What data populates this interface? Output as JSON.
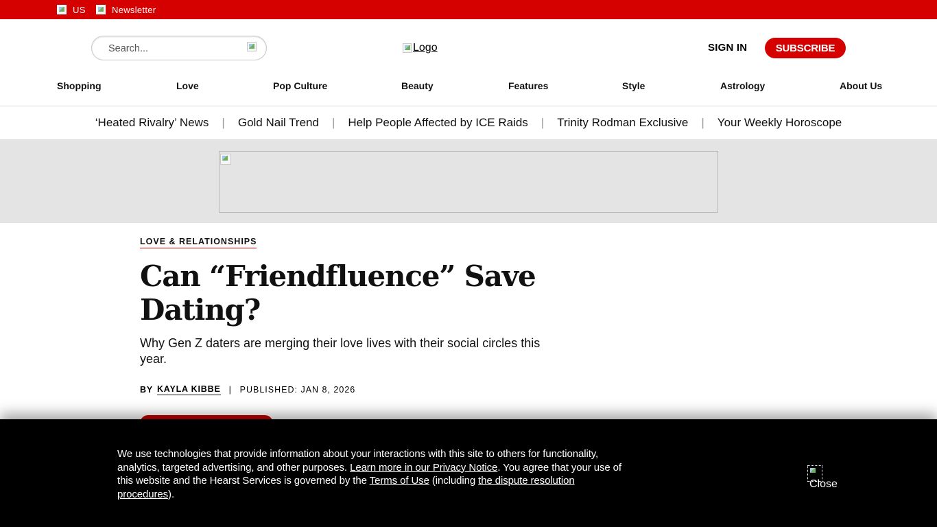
{
  "topbar": {
    "edition_label": "US",
    "newsletter_label": "Newsletter"
  },
  "header": {
    "search_placeholder": "Search...",
    "logo_alt": "Logo",
    "signin_label": "SIGN IN",
    "subscribe_label": "SUBSCRIBE"
  },
  "nav": {
    "items": [
      "Shopping",
      "Love",
      "Pop Culture",
      "Beauty",
      "Features",
      "Style",
      "Astrology",
      "About Us"
    ]
  },
  "trending": {
    "items": [
      "‘Heated Rivalry’ News",
      "Gold Nail Trend",
      "Help People Affected by ICE Raids",
      "Trinity Rodman Exclusive",
      "Your Weekly Horoscope"
    ],
    "separator": "|"
  },
  "article": {
    "category": "LOVE & RELATIONSHIPS",
    "headline": "Can “Friendfluence” Save Dating?",
    "dek": "Why Gen Z daters are merging their love lives with their social circles this year.",
    "by_label": "BY",
    "author": "KAYLA KIBBE",
    "pipe": "|",
    "published": "PUBLISHED: JAN 8, 2026"
  },
  "cookie_banner": {
    "text_1": "We use technologies that provide information about your interactions with this site to others for functionality, analytics, targeted advertising, and other purposes. ",
    "link_privacy": "Learn more in our Privacy Notice",
    "text_2": ". You agree that your use of this website and the Hearst Services is governed by the ",
    "link_terms": "Terms of Use",
    "text_3": " (including ",
    "link_dispute": "the dispute resolution procedures",
    "text_4": ").",
    "close_label": "Close"
  },
  "colors": {
    "brand_red": "#d50000",
    "banner_bg": "#000000",
    "ad_band_bg": "#e4e4e4"
  },
  "icons": {
    "edition_flag": "broken-image-icon",
    "newsletter": "broken-image-icon",
    "search": "broken-image-icon",
    "close": "broken-image-icon"
  }
}
